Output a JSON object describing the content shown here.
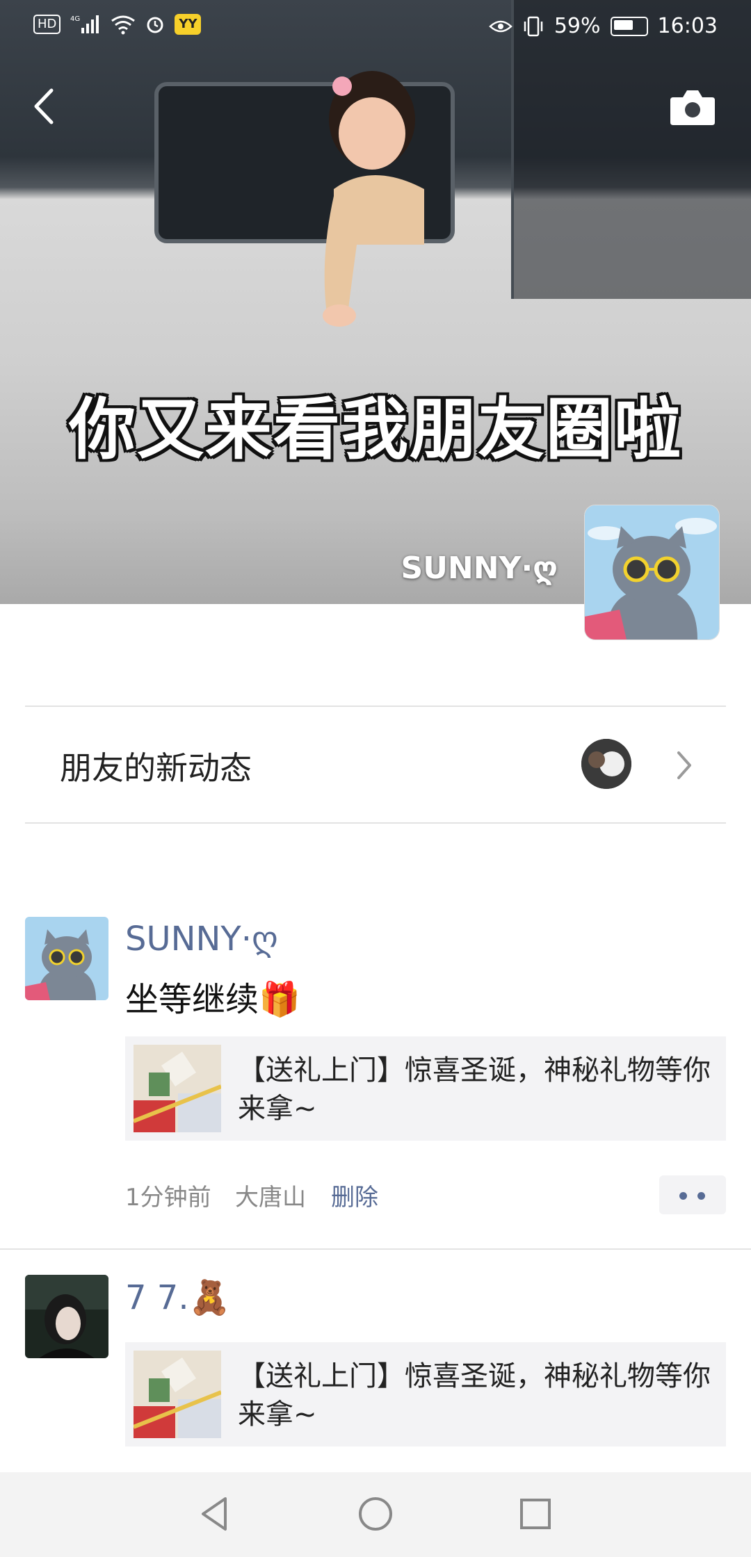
{
  "status_bar": {
    "left_items": [
      "HD",
      "4G",
      "signal-icon",
      "wifi-icon",
      "alarm-icon",
      "YY"
    ],
    "yy_label": "YY",
    "hd_label": "HD",
    "battery_percent": "59%",
    "time": "16:03"
  },
  "cover": {
    "caption": "你又来看我朋友圈啦",
    "username": "SUNNY·ღ"
  },
  "new_activity": {
    "label": "朋友的新动态"
  },
  "posts": [
    {
      "name": "SUNNY·ღ",
      "text": "坐等继续🎁",
      "link_title": "【送礼上门】惊喜圣诞，神秘礼物等你来拿~",
      "time": "1分钟前",
      "location": "大唐山",
      "delete_label": "删除"
    },
    {
      "name": "7 7.🧸",
      "link_title": "【送礼上门】惊喜圣诞，神秘礼物等你来拿~"
    }
  ],
  "colors": {
    "link_blue": "#576b95",
    "card_bg": "#f3f3f5"
  }
}
